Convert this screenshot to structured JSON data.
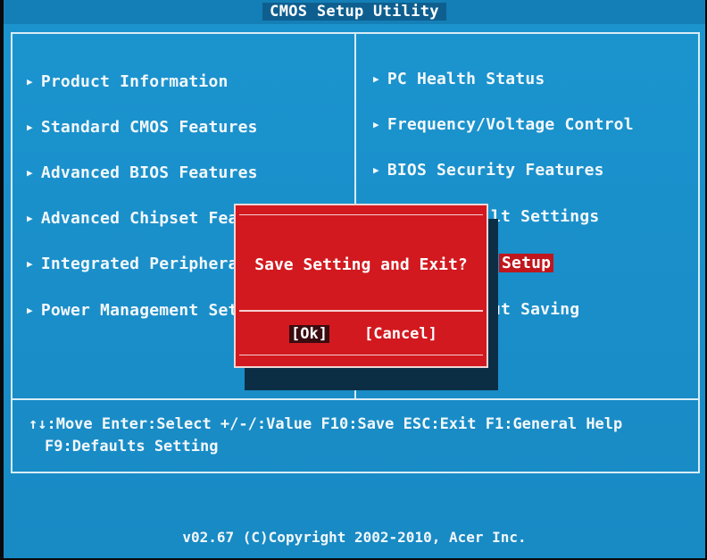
{
  "title": "CMOS Setup Utility",
  "left_menu": [
    "Product Information",
    "Standard CMOS Features",
    "Advanced BIOS Features",
    "Advanced Chipset Feat",
    "Integrated Peripheral",
    "Power Management Setu"
  ],
  "right_menu": [
    "PC Health Status",
    "Frequency/Voltage Control",
    "BIOS Security Features",
    "lt Settings",
    "Setup",
    "ut Saving"
  ],
  "menu_arrow": "▶",
  "help": {
    "line1": "↑↓:Move  Enter:Select  +/-/:Value  F10:Save  ESC:Exit  F1:General Help",
    "line2": "F9:Defaults Setting"
  },
  "dialog": {
    "message": "Save Setting and Exit?",
    "ok": "[Ok]",
    "cancel": "[Cancel]"
  },
  "footer": "v02.67 (C)Copyright 2002-2010, Acer Inc.",
  "colors": {
    "background": "#1a8fca",
    "dialog": "#d2191f",
    "highlight": "#c0161d",
    "text": "#f3f8fb"
  }
}
